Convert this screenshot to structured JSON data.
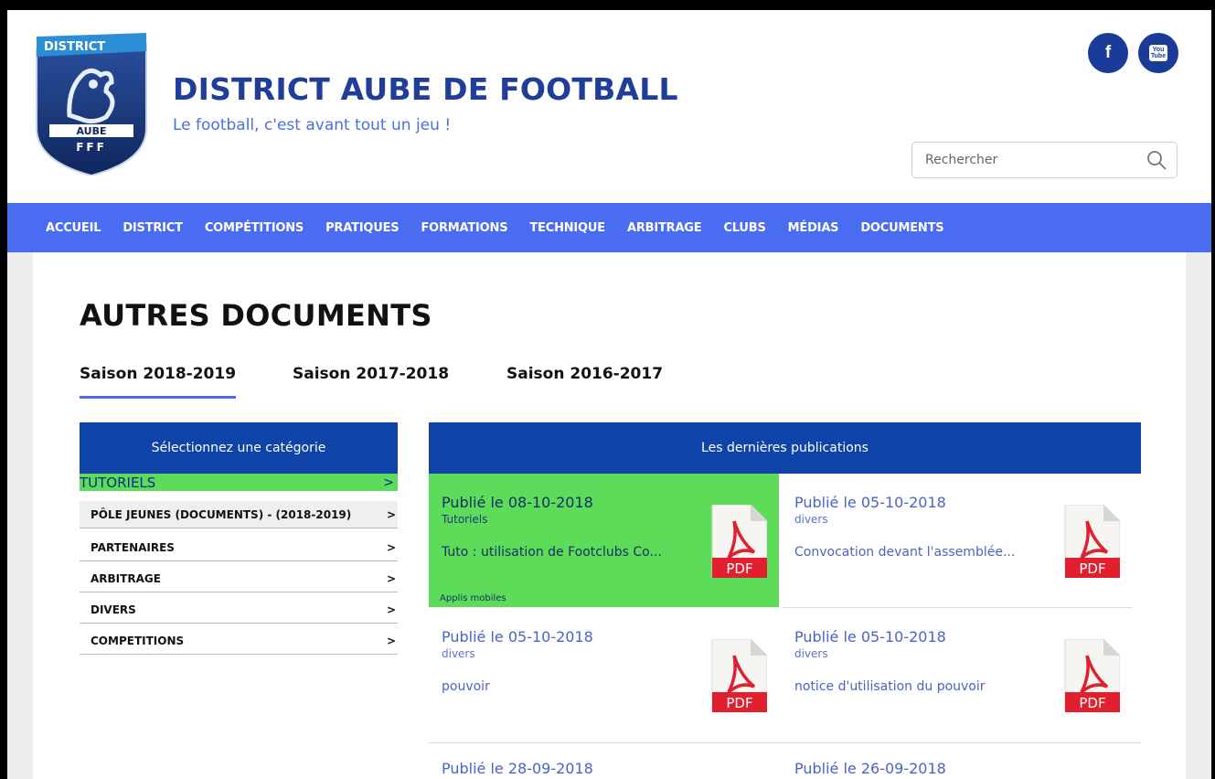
{
  "header": {
    "logo_text_top": "DISTRICT",
    "logo_text_mid": "AUBE",
    "logo_text_bottom": "FFF",
    "site_title": "DISTRICT AUBE DE FOOTBALL",
    "tagline": "Le football, c'est avant tout un jeu !",
    "social": [
      {
        "name": "facebook",
        "label": "f"
      },
      {
        "name": "youtube",
        "label_top": "You",
        "label_bottom": "Tube"
      }
    ],
    "search": {
      "placeholder": "Rechercher",
      "value": ""
    }
  },
  "nav": {
    "items": [
      "ACCUEIL",
      "DISTRICT",
      "COMPÉTITIONS",
      "PRATIQUES",
      "FORMATIONS",
      "TECHNIQUE",
      "ARBITRAGE",
      "CLUBS",
      "MÉDIAS",
      "DOCUMENTS"
    ]
  },
  "main": {
    "title": "AUTRES DOCUMENTS",
    "seasons": [
      {
        "label": "Saison 2018-2019",
        "active": true
      },
      {
        "label": "Saison 2017-2018",
        "active": false
      },
      {
        "label": "Saison 2016-2017",
        "active": false
      }
    ],
    "categories": {
      "header": "Sélectionnez une catégorie",
      "items": [
        {
          "label": "TUTORIELS",
          "arrow": ">",
          "selected": true
        },
        {
          "label": "PÔLE JEUNES (DOCUMENTS) - (2018-2019)",
          "arrow": ">"
        },
        {
          "label": "PARTENAIRES",
          "arrow": ">"
        },
        {
          "label": "ARBITRAGE",
          "arrow": ">"
        },
        {
          "label": "DIVERS",
          "arrow": ">"
        },
        {
          "label": "COMPETITIONS",
          "arrow": ">"
        }
      ]
    },
    "publications": {
      "header": "Les dernières publications",
      "pdf_label": "PDF",
      "items": [
        {
          "date": "Publié le 08-10-2018",
          "category": "Tutoriels",
          "title": "Tuto : utilisation de Footclubs Co...",
          "tag": "Applis mobiles",
          "highlighted": true
        },
        {
          "date": "Publié le 05-10-2018",
          "category": "divers",
          "title": "Convocation devant l'assemblée..."
        },
        {
          "date": "Publié le 05-10-2018",
          "category": "divers",
          "title": "pouvoir"
        },
        {
          "date": "Publié le 05-10-2018",
          "category": "divers",
          "title": "notice d'utilisation du pouvoir"
        },
        {
          "date": "Publié le 28-09-2018",
          "category": "",
          "title": ""
        },
        {
          "date": "Publié le 26-09-2018",
          "category": "",
          "title": ""
        }
      ]
    }
  },
  "colors": {
    "brand_dark_blue": "#1f3d99",
    "nav_blue": "#4a6cf0",
    "panel_header_blue": "#0f43a8",
    "highlight_green": "#5ddc5a",
    "pdf_red": "#e0202f"
  }
}
